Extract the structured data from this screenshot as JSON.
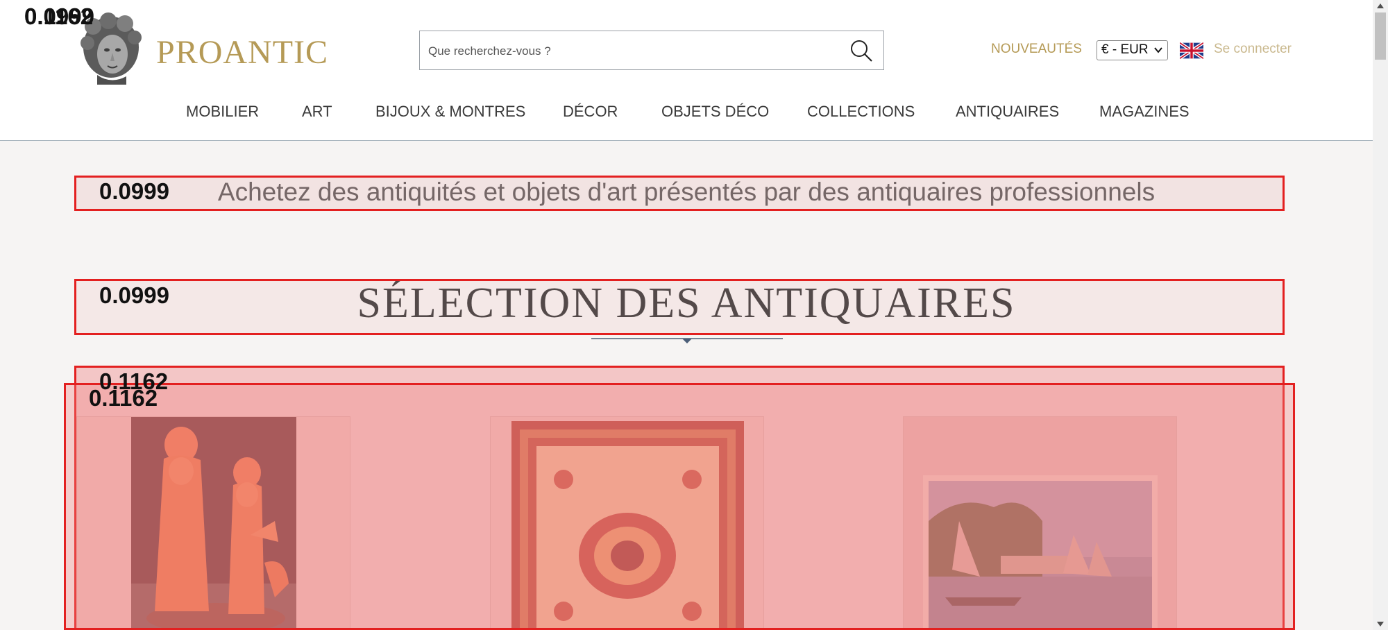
{
  "header": {
    "brand": "PROANTIC",
    "search": {
      "placeholder": "Que recherchez-vous ?"
    },
    "new_label": "NOUVEAUTÉS",
    "currency": "€ - EUR",
    "login_label": "Se connecter"
  },
  "nav": {
    "items": [
      "MOBILIER",
      "ART",
      "BIJOUX & MONTRES",
      "DÉCOR",
      "OBJETS DÉCO",
      "COLLECTIONS",
      "ANTIQUAIRES",
      "MAGAZINES"
    ]
  },
  "main": {
    "tagline": "Achetez des antiquités et objets d'art présentés par des antiquaires professionnels",
    "section_title": "SÉLECTION DES ANTIQUAIRES",
    "products": [
      {
        "icon": "coral-figurines-image"
      },
      {
        "icon": "persian-rug-image"
      },
      {
        "icon": "harbor-painting-image"
      }
    ]
  },
  "overlays": {
    "corner_labels": [
      "0.1162",
      "0.0999"
    ],
    "tagline_score": "0.0999",
    "title_score": "0.0999",
    "products_score_a": "0.1162",
    "products_score_b": "0.1162",
    "colors": {
      "border": "#e32020",
      "fill": "#f5a0a0"
    }
  },
  "colors": {
    "brand_gold": "#b59a56",
    "login_gold": "#c9b88d",
    "page_bg": "#f6f4f3"
  }
}
